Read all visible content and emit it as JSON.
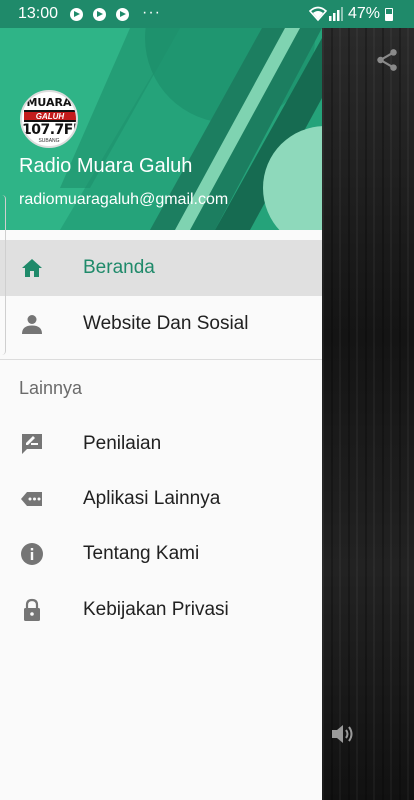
{
  "status_bar": {
    "time": "13:00",
    "notification_icons": [
      "media-notification-icon",
      "media-notification-icon",
      "media-notification-icon"
    ],
    "more": "···",
    "battery": "47%"
  },
  "drawer": {
    "header": {
      "logo_text": {
        "line1": "MUARA",
        "line2": "GALUH",
        "line3": "107.7FM",
        "line4": "SUBANG"
      },
      "name": "Radio Muara Galuh",
      "email": "radiomuaragaluh@gmail.com"
    },
    "items": [
      {
        "label": "Beranda",
        "icon": "home-icon",
        "active": true
      },
      {
        "label": "Website Dan Sosial",
        "icon": "person-icon",
        "active": false
      }
    ],
    "section_label": "Lainnya",
    "section_items": [
      {
        "label": "Penilaian",
        "icon": "rate-review-icon"
      },
      {
        "label": "Aplikasi Lainnya",
        "icon": "more-apps-icon"
      },
      {
        "label": "Tentang Kami",
        "icon": "info-icon"
      },
      {
        "label": "Kebijakan Privasi",
        "icon": "lock-icon"
      }
    ]
  },
  "colors": {
    "primary": "#1f8a6a",
    "header_green": "#25a37a",
    "active_text": "#1f8a6a",
    "active_bg": "#e0e0e0"
  }
}
